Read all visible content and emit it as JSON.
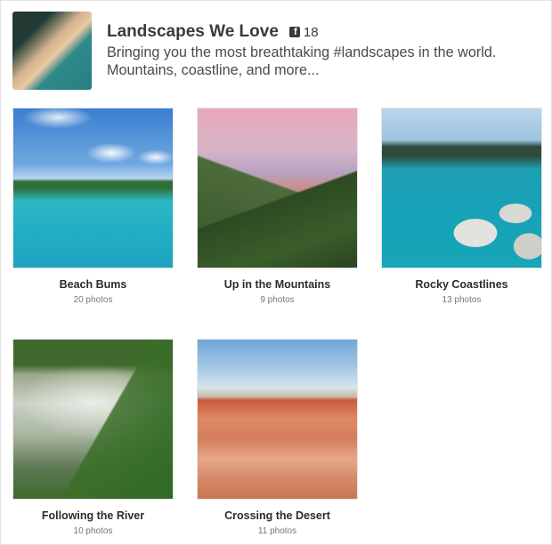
{
  "album": {
    "title": "Landscapes We Love",
    "count_icon": "facebook-square-icon",
    "photo_count": "18",
    "description": "Bringing you the most breathtaking #landscapes in the world. Mountains, coastline, and more..."
  },
  "cards": [
    {
      "title": "Beach Bums",
      "count": "20 photos"
    },
    {
      "title": "Up in the Mountains",
      "count": "9 photos"
    },
    {
      "title": "Rocky Coastlines",
      "count": "13 photos"
    },
    {
      "title": "Following the River",
      "count": "10 photos"
    },
    {
      "title": "Crossing the Desert",
      "count": "11 photos"
    }
  ]
}
